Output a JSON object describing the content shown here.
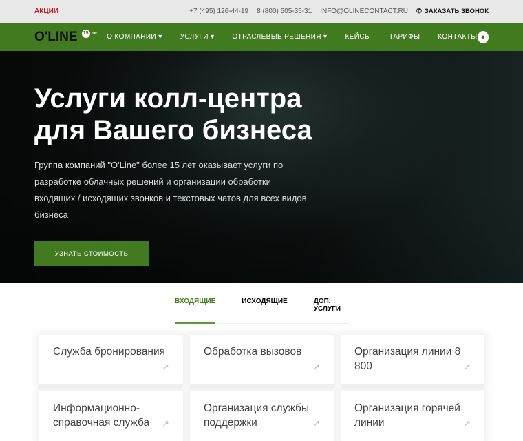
{
  "topbar": {
    "promo": "АКЦИИ",
    "phone1": "+7 (495) 126-44-19",
    "phone2": "8 (800) 505-35-31",
    "email": "INFO@OLINECONTACT.RU",
    "callback": "ЗАКАЗАТЬ ЗВОНОК"
  },
  "nav": {
    "logo": "O'LINE",
    "years_num": "15",
    "years_label": "лет",
    "items": [
      "О КОМПАНИИ",
      "УСЛУГИ",
      "ОТРАСЛЕВЫЕ РЕШЕНИЯ",
      "КЕЙСЫ",
      "ТАРИФЫ",
      "КОНТАКТЫ"
    ]
  },
  "hero": {
    "title": "Услуги колл-центра для Вашего бизнеса",
    "text": "Группа компаний \"O'Line\" более 15 лет оказывает услуги по разработке облачных решений и организации обработки входящих / исходящих звонков и текстовых чатов для всех видов бизнеса",
    "cta": "УЗНАТЬ СТОИМОСТЬ"
  },
  "tabs": [
    "ВХОДЯЩИЕ",
    "ИСХОДЯЩИЕ",
    "ДОП. УСЛУГИ"
  ],
  "cards": [
    "Служба бронирования",
    "Обработка вызовов",
    "Организация линии 8 800",
    "Информационно-справочная служба",
    "Организация службы поддержки",
    "Организация горячей линии"
  ],
  "colors": {
    "brand": "#427a1f",
    "promo": "#c0161b"
  }
}
